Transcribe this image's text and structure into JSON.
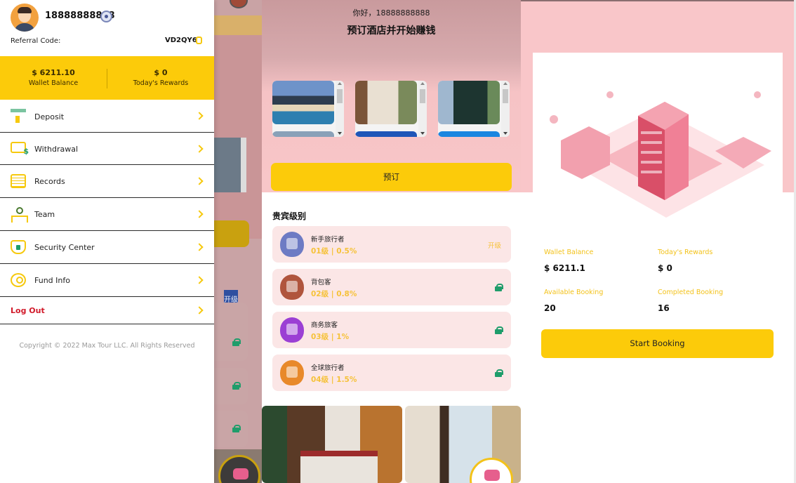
{
  "drawer": {
    "phone": "18888888888",
    "referral_label": "Referral Code:",
    "referral_code": "VD2QY6",
    "wallet": {
      "value": "$ 6211.10",
      "label": "Wallet Balance"
    },
    "rewards": {
      "value": "$ 0",
      "label": "Today's Rewards"
    },
    "menu": [
      {
        "label": "Deposit",
        "icon": "deposit-icon"
      },
      {
        "label": "Withdrawal",
        "icon": "withdrawal-icon"
      },
      {
        "label": "Records",
        "icon": "records-icon"
      },
      {
        "label": "Team",
        "icon": "team-icon"
      },
      {
        "label": "Security Center",
        "icon": "security-icon"
      },
      {
        "label": "Fund Info",
        "icon": "fund-info-icon"
      }
    ],
    "logout": "Log Out",
    "copyright": "Copyright © 2022 Max Tour LLC. All Rights Reserved"
  },
  "background_page": {
    "upgrade_fragment": "开级"
  },
  "booking": {
    "greeting": "你好，18888888888",
    "headline": "预订酒店并开始赚钱",
    "book_button": "预订",
    "vip_title": "贵宾级别",
    "levels": [
      {
        "name": "新手旅行者",
        "rate": "01级 | 0.5%",
        "action": "开级",
        "locked": false,
        "color": "#6d7bc4"
      },
      {
        "name": "背包客",
        "rate": "02级 | 0.8%",
        "locked": true,
        "color": "#b0553d"
      },
      {
        "name": "商务旅客",
        "rate": "03级 | 1%",
        "locked": true,
        "color": "#9b3fd4"
      },
      {
        "name": "全球旅行者",
        "rate": "04级 | 1.5%",
        "locked": true,
        "color": "#e8892a"
      }
    ]
  },
  "stats": {
    "wallet_label": "Wallet Balance",
    "wallet_value": "$ 6211.1",
    "rewards_label": "Today's Rewards",
    "rewards_value": "$ 0",
    "available_label": "Available Booking",
    "available_value": "20",
    "completed_label": "Completed Booking",
    "completed_value": "16",
    "start_button": "Start Booking"
  },
  "colors": {
    "accent": "#fccb0a",
    "hero_pink": "#f8c6c8",
    "logout": "#d11a2a",
    "rate": "#f6c23a"
  }
}
